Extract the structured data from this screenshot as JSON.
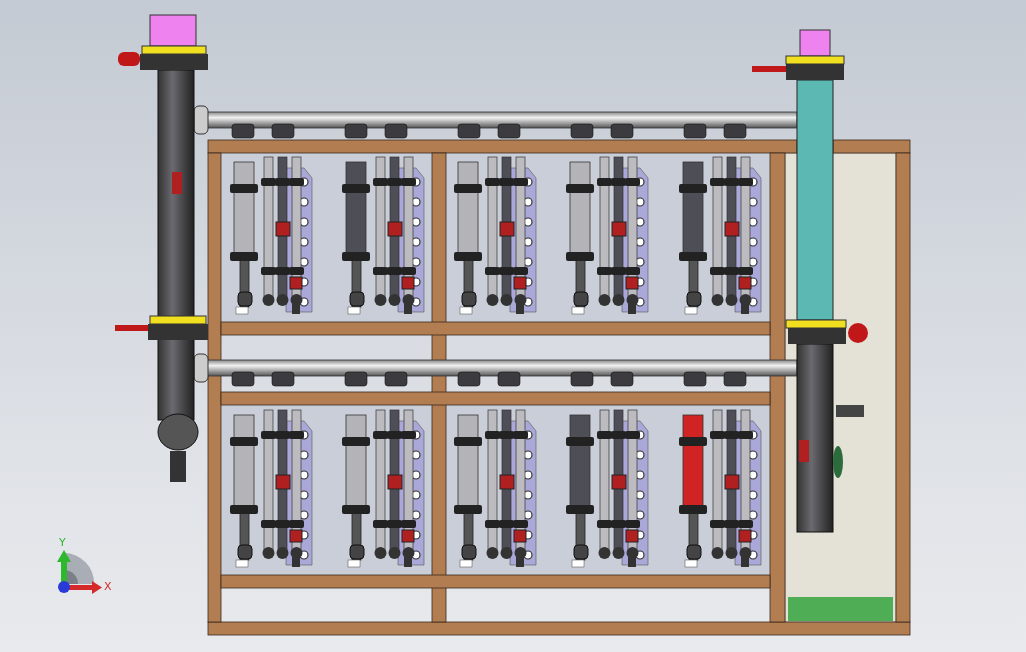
{
  "viewport": {
    "module_rows": [
      {
        "modules": [
          {
            "color": "#b4b4b8"
          },
          {
            "color": "#4e4e56"
          },
          {
            "color": "#b4b4b8"
          },
          {
            "color": "#b4b4b8"
          },
          {
            "color": "#4e4e56"
          }
        ]
      },
      {
        "modules": [
          {
            "color": "#b4b4b8"
          },
          {
            "color": "#b4b4b8"
          },
          {
            "color": "#b4b4b8"
          },
          {
            "color": "#4e4e56"
          },
          {
            "color": "#d02424"
          }
        ]
      }
    ],
    "triad": {
      "y_label": "Y",
      "x_label": "X"
    }
  }
}
